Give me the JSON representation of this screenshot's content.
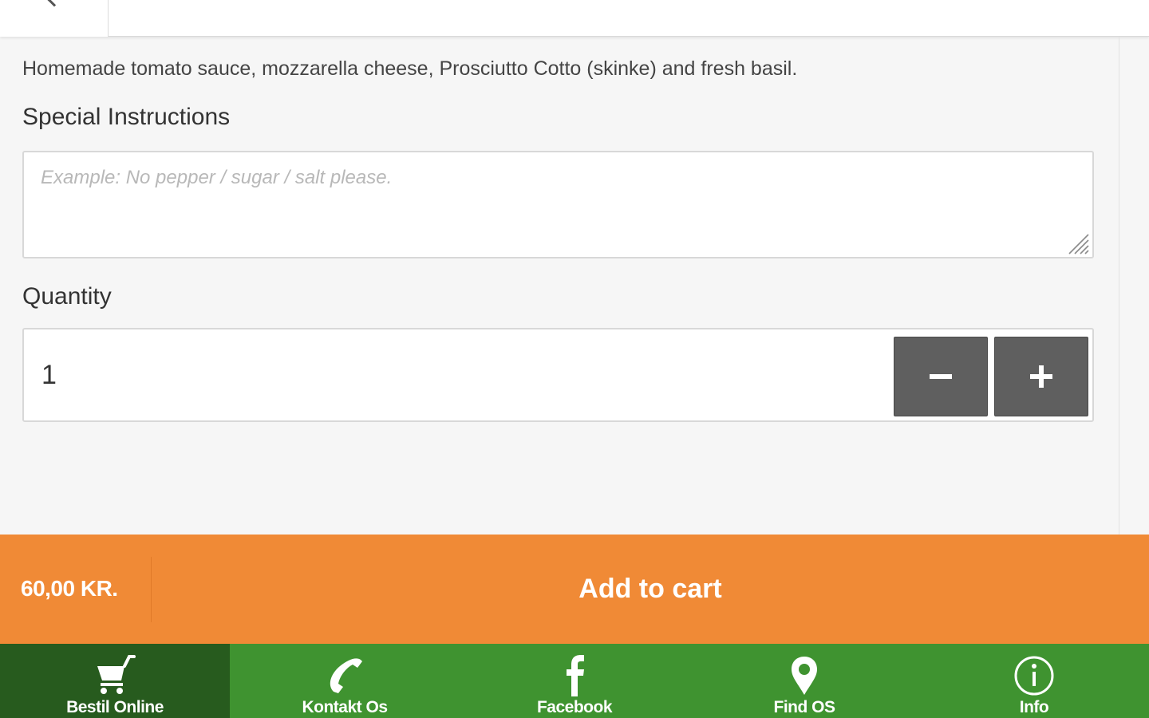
{
  "item": {
    "description": "Homemade tomato sauce, mozzarella cheese, Prosciutto Cotto (skinke) and fresh basil."
  },
  "instructions": {
    "label": "Special Instructions",
    "placeholder": "Example: No pepper / sugar / salt please."
  },
  "quantity": {
    "label": "Quantity",
    "value": "1"
  },
  "cart": {
    "price": "60,00 KR.",
    "add_label": "Add to cart"
  },
  "nav": {
    "items": [
      {
        "label": "Bestil Online",
        "icon": "cart-icon",
        "active": true
      },
      {
        "label": "Kontakt Os",
        "icon": "phone-icon",
        "active": false
      },
      {
        "label": "Facebook",
        "icon": "facebook-icon",
        "active": false
      },
      {
        "label": "Find OS",
        "icon": "map-pin-icon",
        "active": false
      },
      {
        "label": "Info",
        "icon": "info-icon",
        "active": false
      }
    ]
  },
  "colors": {
    "cart_bar": "#f08a36",
    "nav_bg": "#3f9330",
    "nav_active": "#275b1e",
    "stepper": "#5f5f5f"
  }
}
